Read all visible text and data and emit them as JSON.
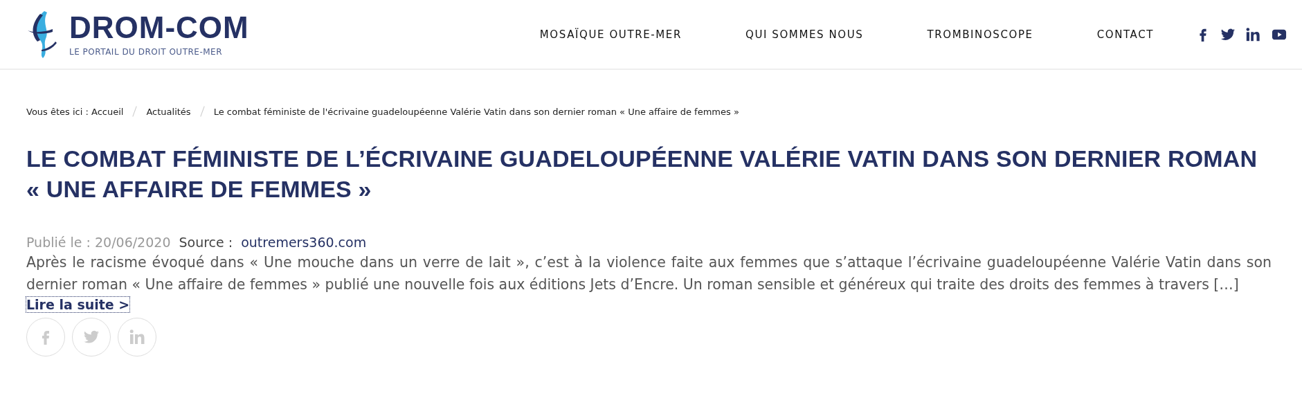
{
  "header": {
    "logo": {
      "name": "DROM-COM",
      "tagline": "LE PORTAIL DU DROIT OUTRE-MER"
    },
    "nav": [
      "MOSAÏQUE OUTRE-MER",
      "QUI SOMMES NOUS",
      "TROMBINOSCOPE",
      "CONTACT"
    ],
    "social": [
      {
        "kind": "facebook"
      },
      {
        "kind": "twitter"
      },
      {
        "kind": "linkedin"
      },
      {
        "kind": "youtube"
      }
    ]
  },
  "breadcrumb": {
    "prefix": "Vous êtes ici :",
    "items": [
      "Accueil",
      "Actualités",
      "Le combat féministe de l'écrivaine guadeloupéenne Valérie Vatin dans son dernier roman « Une affaire de femmes »"
    ]
  },
  "article": {
    "title": "LE COMBAT FÉMINISTE DE L’ÉCRIVAINE GUADELOUPÉENNE VALÉRIE VATIN DANS SON DERNIER ROMAN « UNE AFFAIRE DE FEMMES »",
    "published": "Publié le : 20/06/2020",
    "source_label": "Source :",
    "source": "outremers360.com",
    "excerpt": "Après le racisme évoqué dans « Une mouche dans un verre de lait », c’est à la violence faite aux femmes que s’attaque l’écrivaine guadeloupéenne Valérie Vatin dans son dernier roman « Une affaire de femmes » publié une nouvelle fois aux éditions Jets d’Encre. Un roman sensible et généreux qui traite des droits des femmes à travers […]",
    "read_more": "Lire la suite >",
    "share": [
      {
        "kind": "facebook"
      },
      {
        "kind": "twitter"
      },
      {
        "kind": "linkedin"
      }
    ]
  }
}
